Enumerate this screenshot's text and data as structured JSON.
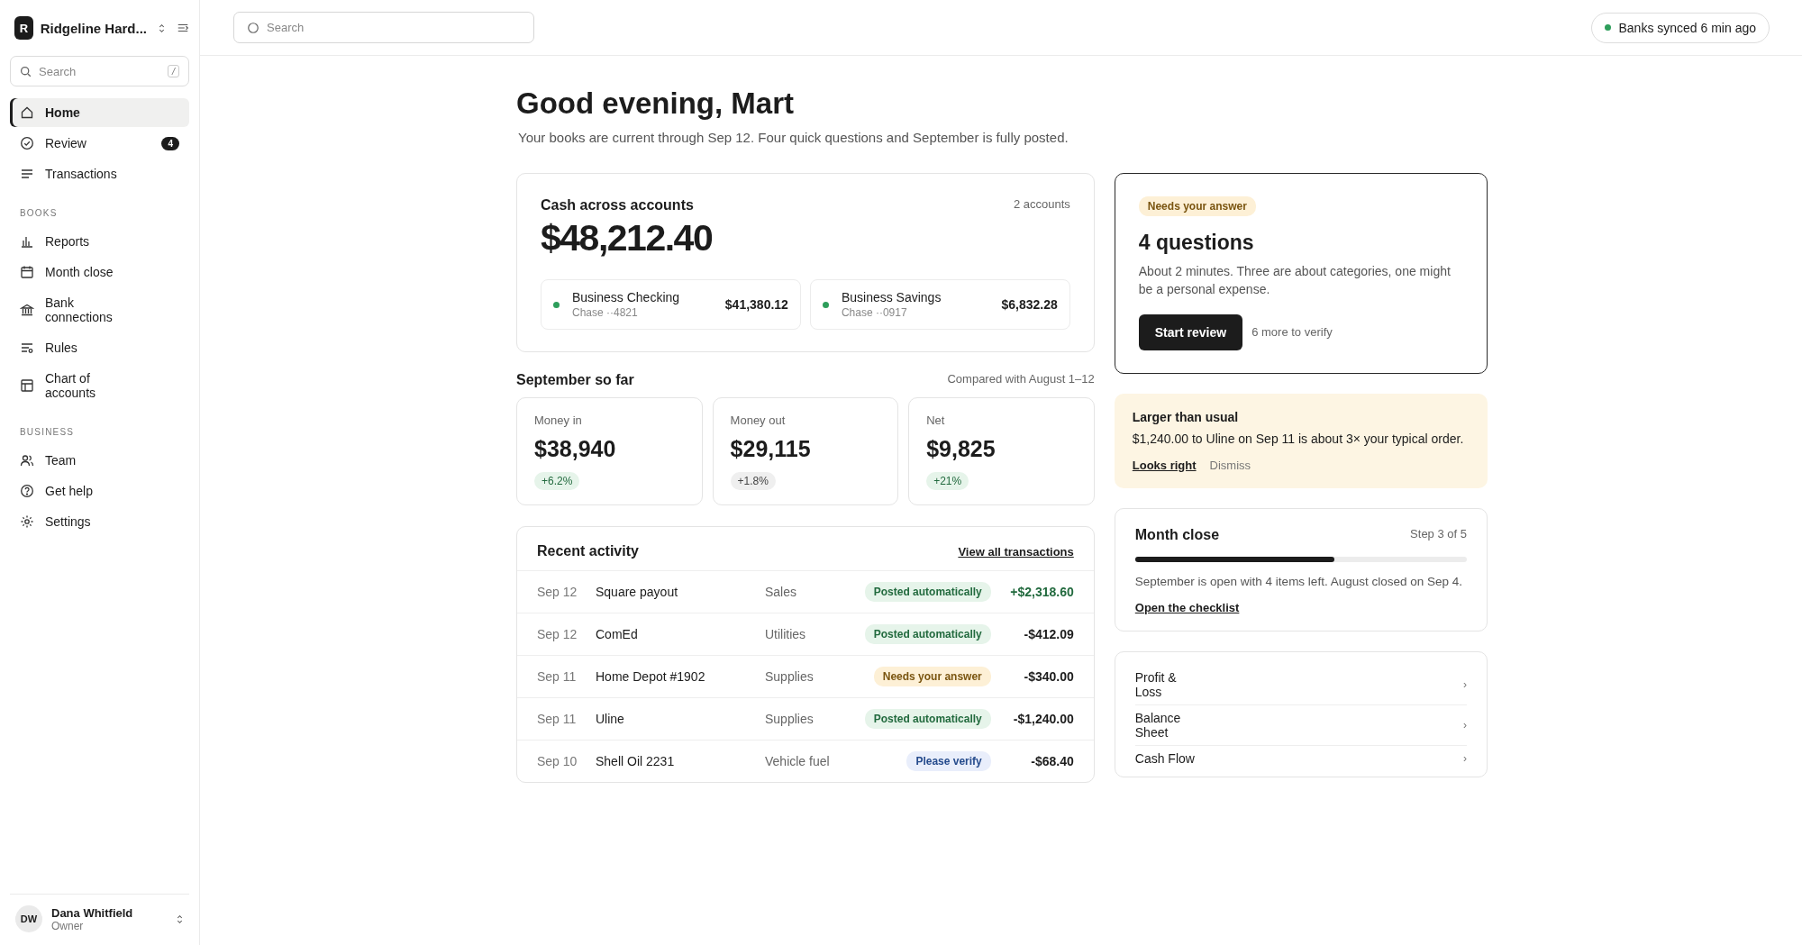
{
  "workspace": {
    "initial": "R",
    "name": "Ridgeline Hard..."
  },
  "sidebar": {
    "search": {
      "placeholder": "Search",
      "shortcut": "/"
    },
    "sections": [
      {
        "items": [
          {
            "label": "Home",
            "selected": true
          },
          {
            "label": "Review",
            "selected": false,
            "badge": "4"
          },
          {
            "label": "Transactions",
            "selected": false
          }
        ]
      },
      {
        "title": "BOOKS",
        "items": [
          {
            "label": "Reports",
            "selected": false
          },
          {
            "label": "Month close",
            "selected": false
          },
          {
            "label": "Bank connections",
            "selected": false
          },
          {
            "label": "Rules",
            "selected": false
          },
          {
            "label": "Chart of accounts",
            "selected": false
          }
        ]
      },
      {
        "title": "BUSINESS",
        "items": [
          {
            "label": "Team",
            "selected": false
          },
          {
            "label": "Get help",
            "selected": false
          },
          {
            "label": "Settings",
            "selected": false
          }
        ]
      }
    ],
    "user": {
      "initials": "DW",
      "name": "Dana Whitfield",
      "role": "Owner"
    }
  },
  "topbar": {
    "search": {
      "placeholder": "Search"
    },
    "sync": {
      "text": "Banks synced 6 min ago",
      "color": "#2e9e5b"
    }
  },
  "greeting": {
    "title": "Good evening, Mart",
    "subtitle": "Your books are current through Sep 12. Four quick questions and September is fully posted."
  },
  "cash": {
    "title": "Cash across accounts",
    "count": "2 accounts",
    "total": "$48,212.40",
    "accounts": [
      {
        "name": "Business Checking",
        "detail": "Chase ··4821",
        "balance": "$41,380.12",
        "color": "#2e9e5b"
      },
      {
        "name": "Business Savings",
        "detail": "Chase ··0917",
        "balance": "$6,832.28",
        "color": "#2e9e5b"
      }
    ]
  },
  "month": {
    "title": "September so far",
    "compare": "Compared with August 1–12",
    "stats": [
      {
        "label": "Money in",
        "value": "$38,940",
        "change": "+6.2%",
        "kind": "positive"
      },
      {
        "label": "Money out",
        "value": "$29,115",
        "change": "+1.8%",
        "kind": "neutral"
      },
      {
        "label": "Net",
        "value": "$9,825",
        "change": "+21%",
        "kind": "positive"
      }
    ]
  },
  "activity": {
    "title": "Recent activity",
    "link": "View all transactions",
    "rows": [
      {
        "date": "Sep 12",
        "payee": "Square payout",
        "category": "Sales",
        "status": "Posted automatically",
        "kind": "posted",
        "amount": "+$2,318.60",
        "incoming": true
      },
      {
        "date": "Sep 12",
        "payee": "ComEd",
        "category": "Utilities",
        "status": "Posted automatically",
        "kind": "posted",
        "amount": "-$412.09",
        "incoming": false
      },
      {
        "date": "Sep 11",
        "payee": "Home Depot #1902",
        "category": "Supplies",
        "status": "Needs your answer",
        "kind": "question",
        "amount": "-$340.00",
        "incoming": false
      },
      {
        "date": "Sep 11",
        "payee": "Uline",
        "category": "Supplies",
        "status": "Posted automatically",
        "kind": "posted",
        "amount": "-$1,240.00",
        "incoming": false
      },
      {
        "date": "Sep 10",
        "payee": "Shell Oil 2231",
        "category": "Vehicle fuel",
        "status": "Please verify",
        "kind": "verify",
        "amount": "-$68.40",
        "incoming": false
      }
    ]
  },
  "questions": {
    "tag": "Needs your answer",
    "title": "4 questions",
    "text": "About 2 minutes. Three are about categories, one might be a personal expense.",
    "button": "Start review",
    "note": "6 more to verify"
  },
  "alert": {
    "title": "Larger than usual",
    "text": "$1,240.00 to Uline on Sep 11 is about 3× your typical order.",
    "confirm": "Looks right",
    "dismiss": "Dismiss"
  },
  "close": {
    "title": "Month close",
    "step": "Step 3 of 5",
    "level": 0.6,
    "text": "September is open with 4 items left. August closed on Sep 4.",
    "link": "Open the checklist"
  },
  "reports": [
    {
      "label": "Profit & Loss",
      "chevron": "›"
    },
    {
      "label": "Balance Sheet",
      "chevron": "›"
    },
    {
      "label": "Cash Flow",
      "chevron": "›"
    }
  ]
}
